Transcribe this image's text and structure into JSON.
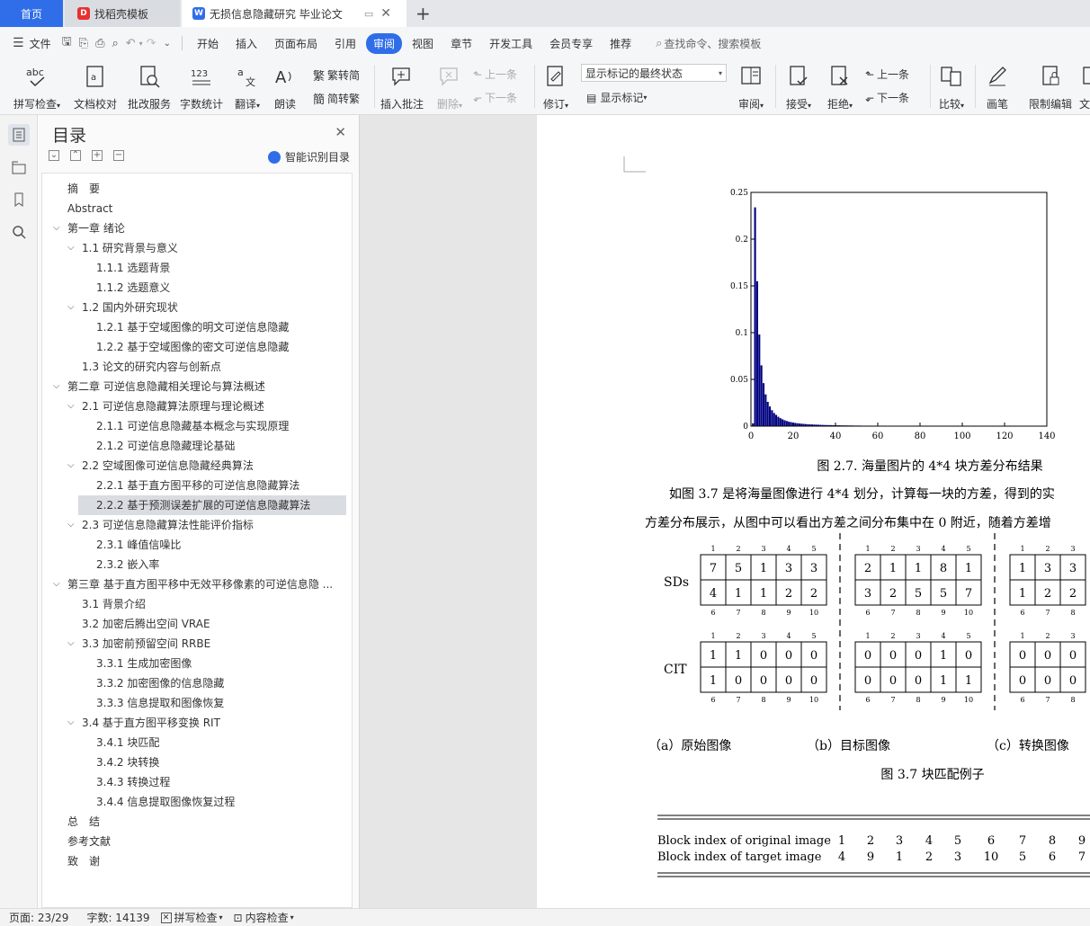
{
  "tabs": {
    "home": "首页",
    "templates": "找稻壳模板",
    "document": "无损信息隐藏研究 毕业论文"
  },
  "menu": {
    "file": "文件",
    "items": [
      "开始",
      "插入",
      "页面布局",
      "引用",
      "审阅",
      "视图",
      "章节",
      "开发工具",
      "会员专享",
      "推荐"
    ],
    "active_index": 4,
    "search": "查找命令、搜索模板"
  },
  "ribbon": {
    "spell_check": "拼写检查",
    "doc_proof": "文档校对",
    "correction_service": "批改服务",
    "word_count": "字数统计",
    "translate": "翻译",
    "read_aloud": "朗读",
    "trad_to_simp": "繁转简",
    "simp_to_trad": "简转繁",
    "insert_comment": "插入批注",
    "delete": "删除",
    "prev_comment": "上一条",
    "next_comment": "下一条",
    "track_changes": "修订",
    "display_select": "显示标记的最终状态",
    "show_markup": "显示标记",
    "review": "审阅",
    "accept": "接受",
    "reject": "拒绝",
    "prev_change": "上一条",
    "next_change": "下一条",
    "compare": "比较",
    "pen": "画笔",
    "restrict_edit": "限制编辑",
    "more": "文"
  },
  "toc": {
    "title": "目录",
    "smart": "智能识别目录",
    "items": [
      {
        "text": "摘　要",
        "level": 0,
        "exp": ""
      },
      {
        "text": "Abstract",
        "level": 0,
        "exp": ""
      },
      {
        "text": "第一章 绪论",
        "level": 0,
        "exp": "v"
      },
      {
        "text": "1.1 研究背景与意义",
        "level": 1,
        "exp": "v"
      },
      {
        "text": "1.1.1 选题背景",
        "level": 2,
        "exp": ""
      },
      {
        "text": "1.1.2 选题意义",
        "level": 2,
        "exp": ""
      },
      {
        "text": "1.2 国内外研究现状",
        "level": 1,
        "exp": "v"
      },
      {
        "text": "1.2.1 基于空域图像的明文可逆信息隐藏",
        "level": 2,
        "exp": ""
      },
      {
        "text": "1.2.2 基于空域图像的密文可逆信息隐藏",
        "level": 2,
        "exp": ""
      },
      {
        "text": "1.3 论文的研究内容与创新点",
        "level": 1,
        "exp": ""
      },
      {
        "text": "第二章 可逆信息隐藏相关理论与算法概述",
        "level": 0,
        "exp": "v"
      },
      {
        "text": "2.1 可逆信息隐藏算法原理与理论概述",
        "level": 1,
        "exp": "v"
      },
      {
        "text": "2.1.1 可逆信息隐藏基本概念与实现原理",
        "level": 2,
        "exp": ""
      },
      {
        "text": "2.1.2 可逆信息隐藏理论基础",
        "level": 2,
        "exp": ""
      },
      {
        "text": "2.2 空域图像可逆信息隐藏经典算法",
        "level": 1,
        "exp": "v"
      },
      {
        "text": "2.2.1 基于直方图平移的可逆信息隐藏算法",
        "level": 2,
        "exp": ""
      },
      {
        "text": "2.2.2 基于预测误差扩展的可逆信息隐藏算法",
        "level": 2,
        "exp": "",
        "selected": true
      },
      {
        "text": "2.3 可逆信息隐藏算法性能评价指标",
        "level": 1,
        "exp": "v"
      },
      {
        "text": "2.3.1 峰值信噪比",
        "level": 2,
        "exp": ""
      },
      {
        "text": "2.3.2 嵌入率",
        "level": 2,
        "exp": ""
      },
      {
        "text": "第三章 基于直方图平移中无效平移像素的可逆信息隐 ...",
        "level": 0,
        "exp": "v"
      },
      {
        "text": "3.1 背景介绍",
        "level": 1,
        "exp": ""
      },
      {
        "text": "3.2 加密后腾出空间 VRAE",
        "level": 1,
        "exp": ""
      },
      {
        "text": "3.3 加密前预留空间 RRBE",
        "level": 1,
        "exp": "v"
      },
      {
        "text": "3.3.1 生成加密图像",
        "level": 2,
        "exp": ""
      },
      {
        "text": "3.3.2 加密图像的信息隐藏",
        "level": 2,
        "exp": ""
      },
      {
        "text": "3.3.3 信息提取和图像恢复",
        "level": 2,
        "exp": ""
      },
      {
        "text": "3.4 基于直方图平移变换 RIT",
        "level": 1,
        "exp": "v"
      },
      {
        "text": "3.4.1 块匹配",
        "level": 2,
        "exp": ""
      },
      {
        "text": "3.4.2 块转换",
        "level": 2,
        "exp": ""
      },
      {
        "text": "3.4.3 转换过程",
        "level": 2,
        "exp": ""
      },
      {
        "text": "3.4.4 信息提取图像恢复过程",
        "level": 2,
        "exp": ""
      },
      {
        "text": "总　结",
        "level": 0,
        "exp": ""
      },
      {
        "text": "参考文献",
        "level": 0,
        "exp": ""
      },
      {
        "text": "致　谢",
        "level": 0,
        "exp": ""
      }
    ]
  },
  "doc": {
    "fig27_caption": "图 2.7. 海量图片的 4*4 块方差分布结果",
    "para1": "如图 3.7 是将海量图像进行 4*4 划分，计算每一块的方差，得到的实",
    "para2": "方差分布展示，从图中可以看出方差之间分布集中在 0 附近，随着方差增",
    "fig37_caption": "图 3.7 块匹配例子",
    "sub_a": "（a）原始图像",
    "sub_b": "（b）目标图像",
    "sub_c": "（c）转换图像",
    "row_sds": "SDs",
    "row_cit": "CIT",
    "top_idx": [
      "1",
      "2",
      "3",
      "4",
      "5"
    ],
    "bottom_idx": [
      "6",
      "7",
      "8",
      "9",
      "10"
    ],
    "grids": {
      "a_sds": [
        [
          "7",
          "5",
          "1",
          "3",
          "3"
        ],
        [
          "4",
          "1",
          "1",
          "2",
          "2"
        ]
      ],
      "a_cit": [
        [
          "1",
          "1",
          "0",
          "0",
          "0"
        ],
        [
          "1",
          "0",
          "0",
          "0",
          "0"
        ]
      ],
      "b_sds": [
        [
          "2",
          "1",
          "1",
          "8",
          "1"
        ],
        [
          "3",
          "2",
          "5",
          "5",
          "7"
        ]
      ],
      "b_cit": [
        [
          "0",
          "0",
          "0",
          "1",
          "0"
        ],
        [
          "0",
          "0",
          "0",
          "1",
          "1"
        ]
      ],
      "c_sds": [
        [
          "1",
          "3",
          "3"
        ],
        [
          "1",
          "2",
          "2"
        ]
      ],
      "c_cit": [
        [
          "0",
          "0",
          "0"
        ],
        [
          "0",
          "0",
          "0"
        ]
      ]
    },
    "table": {
      "row1_label": "Block index of original image",
      "row1": [
        "1",
        "2",
        "3",
        "4",
        "5",
        "6",
        "7",
        "8",
        "9"
      ],
      "row2_label": "Block index of target image",
      "row2": [
        "4",
        "9",
        "1",
        "2",
        "3",
        "10",
        "5",
        "6",
        "7"
      ]
    }
  },
  "chart_data": {
    "type": "bar",
    "xlim": [
      0,
      140
    ],
    "ylim": [
      0,
      0.25
    ],
    "xticks": [
      "0",
      "20",
      "40",
      "60",
      "80",
      "100",
      "120",
      "140"
    ],
    "yticks": [
      "0",
      "0.05",
      "0.1",
      "0.15",
      "0.2",
      "0.25"
    ],
    "x": [
      1,
      2,
      3,
      4,
      5,
      6,
      7,
      8,
      9,
      10,
      11,
      12,
      13,
      14,
      15,
      16,
      17,
      18,
      19,
      20,
      21,
      22,
      23,
      24,
      25,
      26,
      27,
      28,
      29,
      30,
      31,
      32,
      33,
      34,
      35,
      36,
      37,
      38,
      39,
      40,
      41,
      42,
      43,
      44,
      45,
      46,
      47,
      48,
      49,
      50,
      51,
      52,
      53,
      54,
      55,
      56,
      57,
      58,
      59,
      60,
      61,
      62,
      63,
      64,
      65,
      66,
      67,
      68,
      69,
      70,
      71,
      72,
      73,
      74,
      75,
      76,
      77,
      78,
      79,
      80,
      81,
      82,
      83,
      84,
      85,
      86,
      87,
      88,
      89,
      90,
      91,
      92,
      93,
      94,
      95,
      96,
      97,
      98,
      99,
      100,
      101,
      102,
      103,
      104,
      105,
      106,
      107,
      108,
      109,
      110,
      111,
      112,
      113,
      114,
      115,
      116,
      117,
      118,
      119,
      120
    ],
    "values": [
      0.003,
      0.234,
      0.155,
      0.098,
      0.065,
      0.046,
      0.034,
      0.026,
      0.021,
      0.017,
      0.014,
      0.012,
      0.01,
      0.0085,
      0.0073,
      0.0063,
      0.0055,
      0.0048,
      0.0043,
      0.0038,
      0.0034,
      0.0031,
      0.0028,
      0.0026,
      0.0024,
      0.0022,
      0.002,
      0.0019,
      0.0018,
      0.0017,
      0.0016,
      0.0015,
      0.0014,
      0.0013,
      0.0012,
      0.0012,
      0.0011,
      0.0011,
      0.001,
      0.001,
      0.0009,
      0.0009,
      0.0008,
      0.0008,
      0.0008,
      0.0007,
      0.0007,
      0.0007,
      0.0006,
      0.0006,
      0.0006,
      0.0006,
      0.0005,
      0.0005,
      0.0005,
      0.0005,
      0.0005,
      0.0004,
      0.0004,
      0.0004,
      0.0004,
      0.0004,
      0.0004,
      0.0003,
      0.0003,
      0.0003,
      0.0003,
      0.0003,
      0.0003,
      0.0003,
      0.0003,
      0.0002,
      0.0002,
      0.0002,
      0.0002,
      0.0002,
      0.0002,
      0.0002,
      0.0002,
      0.0002,
      0.0002,
      0.0002,
      0.0002,
      0.0001,
      0.0001,
      0.0001,
      0.0001,
      0.0001,
      0.0001,
      0.0001,
      0.0001,
      0.0001,
      0.0001,
      0.0001,
      0.0001,
      0.0001,
      0.0001,
      0.0001,
      0.0001,
      0.0001,
      0.0001,
      0.0001,
      0.0001,
      0.0001,
      0.0001,
      0.0001,
      0.0001,
      0.0001,
      0.0001,
      0.0001,
      0.0001,
      0.0001,
      0.0001,
      0.0001,
      0.0001,
      0.0001,
      0.0001,
      0.0001,
      0.0001,
      0.0001
    ]
  },
  "status": {
    "page": "页面: 23/29",
    "words": "字数: 14139",
    "spell": "拼写检查",
    "content_check": "内容检查"
  },
  "colors": {
    "accent": "#2f6ee8",
    "bar": "#000080"
  }
}
